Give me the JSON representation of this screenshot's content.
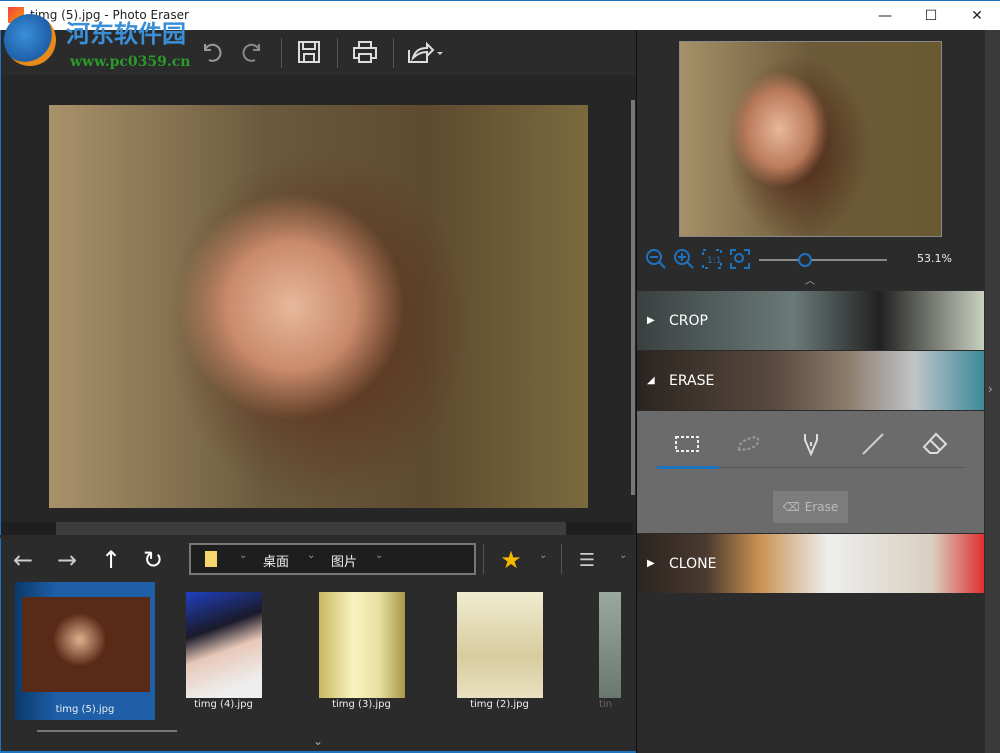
{
  "window": {
    "title": "timg (5).jpg - Photo Eraser",
    "minimize": "—",
    "maximize": "☐",
    "close": "✕"
  },
  "watermark": {
    "name": "河东软件园",
    "url": "www.pc0359.cn"
  },
  "toolbar": {
    "icons": [
      "undo-icon",
      "redo-icon",
      "save-icon",
      "print-icon",
      "share-icon"
    ]
  },
  "nav": {
    "path": [
      "桌面",
      "图片"
    ]
  },
  "thumbnails": [
    {
      "label": "timg (5).jpg",
      "selected": true
    },
    {
      "label": "timg (4).jpg"
    },
    {
      "label": "timg (3).jpg"
    },
    {
      "label": "timg (2).jpg"
    },
    {
      "label": "tin"
    }
  ],
  "zoom": {
    "value": "53.1%",
    "slider_fraction": 0.36
  },
  "panels": {
    "crop": "CROP",
    "erase": "ERASE",
    "clone": "CLONE"
  },
  "erase": {
    "button": "Erase",
    "active_tool": "rectangle-select"
  },
  "colors": {
    "accent": "#1e73be",
    "star": "#f5b800"
  }
}
